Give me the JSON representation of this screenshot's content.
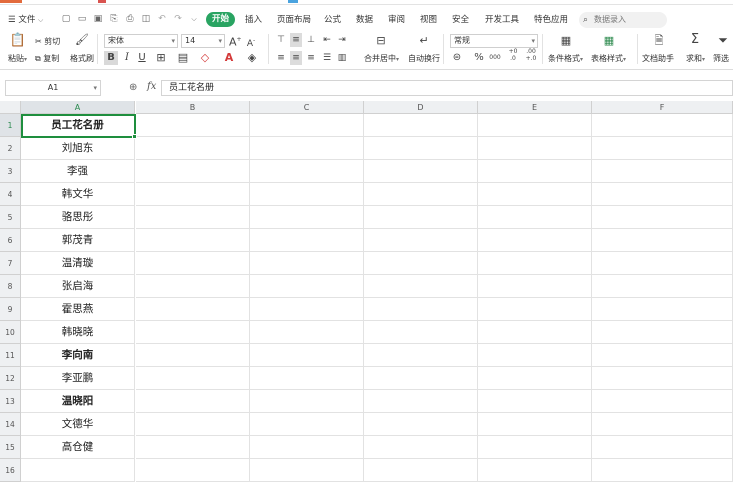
{
  "app": {
    "accent": "#29a462",
    "active_cell_color": "#1e8e3e"
  },
  "menubar": {
    "file_label": "文件",
    "tabs": [
      "开始",
      "插入",
      "页面布局",
      "公式",
      "数据",
      "审阅",
      "视图",
      "安全",
      "开发工具",
      "特色应用"
    ],
    "active_tab": "开始",
    "search_placeholder": "数据录入"
  },
  "toolbar": {
    "paste": "粘贴",
    "cut": "剪切",
    "copy": "复制",
    "format_painter": "格式刷",
    "font_name": "宋体",
    "font_size": "14",
    "grow_font": "A",
    "shrink_font": "A",
    "bold": "B",
    "italic": "I",
    "underline": "U",
    "merge_center": "合并居中",
    "wrap_text": "自动换行",
    "number_format": "常规",
    "percent": "%",
    "thousands": "000",
    "inc_decimal": "+0 .0",
    "dec_decimal": ".00 +.0",
    "conditional_format": "条件格式",
    "table_style": "表格样式",
    "doc_helper": "文档助手",
    "sum": "求和",
    "filter": "筛选"
  },
  "formula_bar": {
    "name_box": "A1",
    "fx_label": "fx",
    "content": "员工花名册"
  },
  "sheet": {
    "columns": [
      "A",
      "B",
      "C",
      "D",
      "E",
      "F"
    ],
    "row_numbers": [
      "1",
      "2",
      "3",
      "4",
      "5",
      "6",
      "7",
      "8",
      "9",
      "10",
      "11",
      "12",
      "13",
      "14",
      "15",
      "16"
    ],
    "selected_cell": "A1",
    "column_a": [
      {
        "text": "员工花名册",
        "bold": true
      },
      {
        "text": "刘旭东",
        "bold": false
      },
      {
        "text": "李强",
        "bold": false
      },
      {
        "text": "韩文华",
        "bold": false
      },
      {
        "text": "骆思彤",
        "bold": false
      },
      {
        "text": "郭茂青",
        "bold": false
      },
      {
        "text": "温清璇",
        "bold": false
      },
      {
        "text": "张启海",
        "bold": false
      },
      {
        "text": "霍思燕",
        "bold": false
      },
      {
        "text": "韩晓晓",
        "bold": false
      },
      {
        "text": "李向南",
        "bold": true
      },
      {
        "text": "李亚鹏",
        "bold": false
      },
      {
        "text": "温晓阳",
        "bold": true
      },
      {
        "text": "文德华",
        "bold": false
      },
      {
        "text": "高仓健",
        "bold": false
      },
      {
        "text": "",
        "bold": false
      }
    ]
  }
}
